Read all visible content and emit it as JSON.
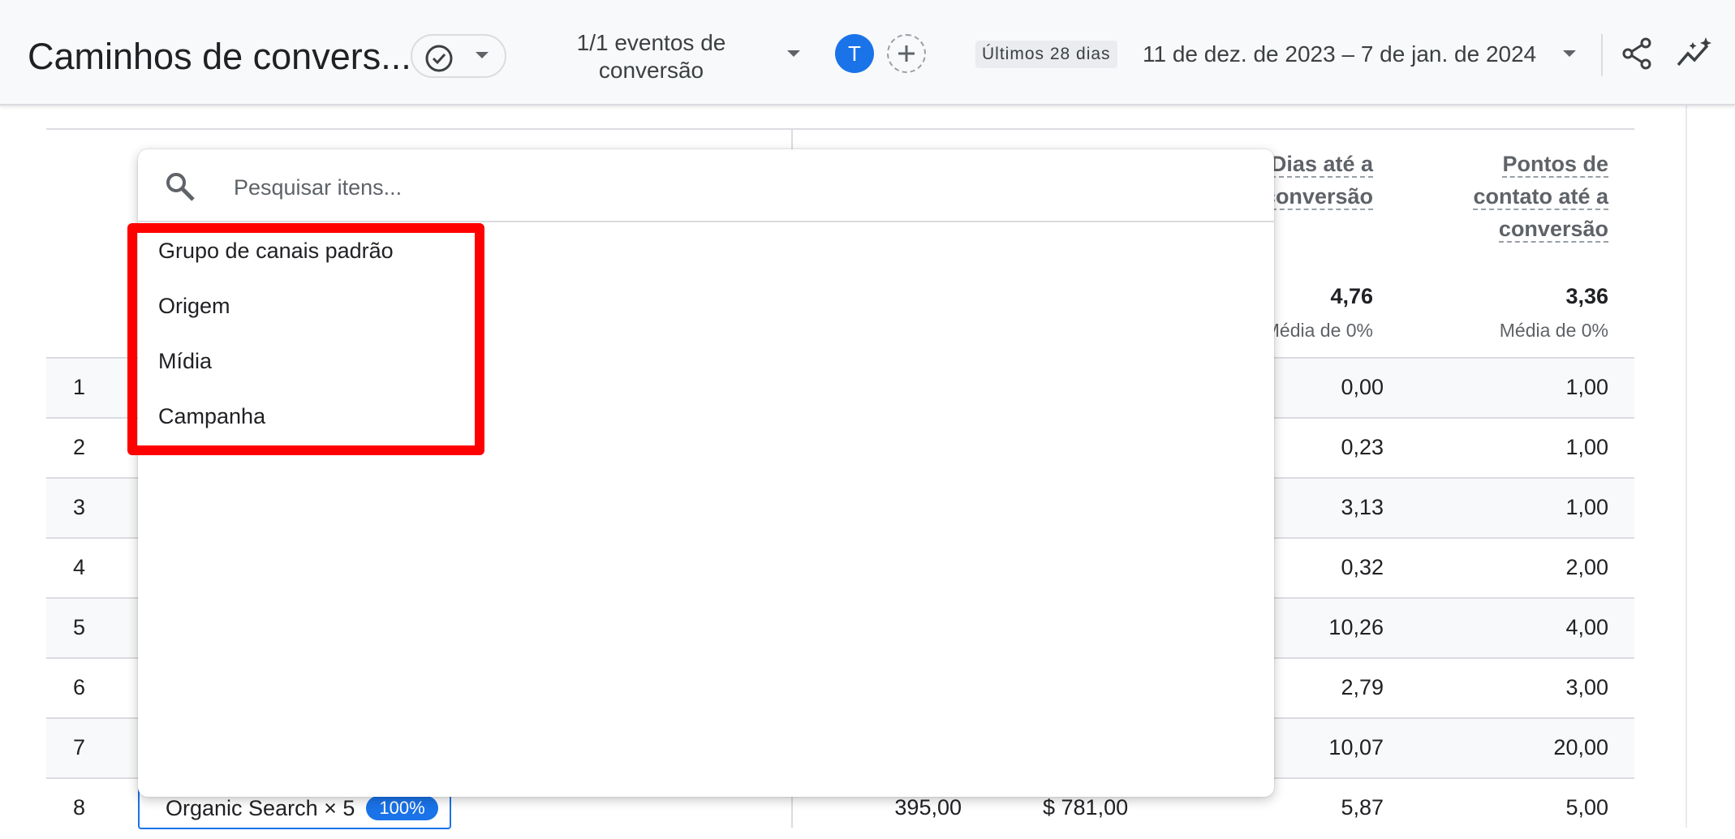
{
  "header": {
    "title": "Caminhos de convers...",
    "conversion_events": "1/1 eventos de conversão",
    "avatar_letter": "T",
    "date_preset": "Últimos 28 dias",
    "date_range": "11 de dez. de 2023 – 7 de jan. de 2024"
  },
  "table": {
    "metric_headers": [
      "Dias até a conversão",
      "Pontos de contato até a conversão"
    ],
    "totals": [
      {
        "value": "4,76",
        "sub": "Média de 0%"
      },
      {
        "value": "3,36",
        "sub": "Média de 0%"
      }
    ],
    "rows": [
      {
        "n": "1",
        "days": "0,00",
        "touch": "1,00"
      },
      {
        "n": "2",
        "days": "0,23",
        "touch": "1,00"
      },
      {
        "n": "3",
        "days": "3,13",
        "touch": "1,00"
      },
      {
        "n": "4",
        "days": "0,32",
        "touch": "2,00"
      },
      {
        "n": "5",
        "days": "10,26",
        "touch": "4,00"
      },
      {
        "n": "6",
        "days": "2,79",
        "touch": "3,00"
      },
      {
        "n": "7",
        "days": "10,07",
        "touch": "20,00"
      },
      {
        "n": "8",
        "path": "Organic Search × 5",
        "pct": "100%",
        "conversions": "395,00",
        "revenue": "$ 781,00",
        "days": "5,87",
        "touch": "5,00"
      }
    ]
  },
  "dropdown": {
    "search_placeholder": "Pesquisar itens...",
    "items": [
      "Grupo de canais padrão",
      "Origem",
      "Mídia",
      "Campanha"
    ]
  },
  "colors": {
    "accent": "#1a73e8",
    "highlight": "#ff0000"
  }
}
